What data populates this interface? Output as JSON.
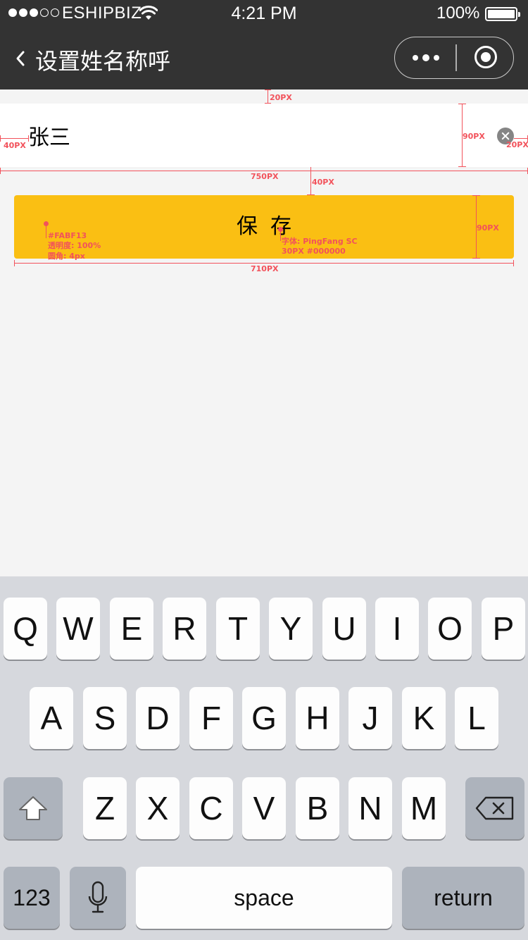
{
  "status_bar": {
    "carrier": "ESHIPBIZ",
    "time": "4:21 PM",
    "battery": "100%"
  },
  "nav": {
    "title": "设置姓名称呼"
  },
  "form": {
    "name_value": "张三",
    "save_label": "保存"
  },
  "annotations": {
    "top_gap": "20PX",
    "left_padding": "40PX",
    "row_height": "90PX",
    "right_padding": "20PX",
    "full_width": "750PX",
    "button_gap": "40PX",
    "button_height": "90PX",
    "button_width": "710PX",
    "button_color": "#FABF13",
    "button_opacity": "透明度: 100%",
    "button_radius": "圆角: 4px",
    "font_family": "字体: PingFang SC",
    "font_spec": "30PX #000000"
  },
  "keyboard": {
    "row1": [
      "Q",
      "W",
      "E",
      "R",
      "T",
      "Y",
      "U",
      "I",
      "O",
      "P"
    ],
    "row2": [
      "A",
      "S",
      "D",
      "F",
      "G",
      "H",
      "J",
      "K",
      "L"
    ],
    "row3": [
      "Z",
      "X",
      "C",
      "V",
      "B",
      "N",
      "M"
    ],
    "numbers_label": "123",
    "space_label": "space",
    "return_label": "return"
  },
  "colors": {
    "header_bg": "#333333",
    "page_bg": "#f4f4f4",
    "accent": "#FABF13",
    "annotation": "#f2525b"
  }
}
